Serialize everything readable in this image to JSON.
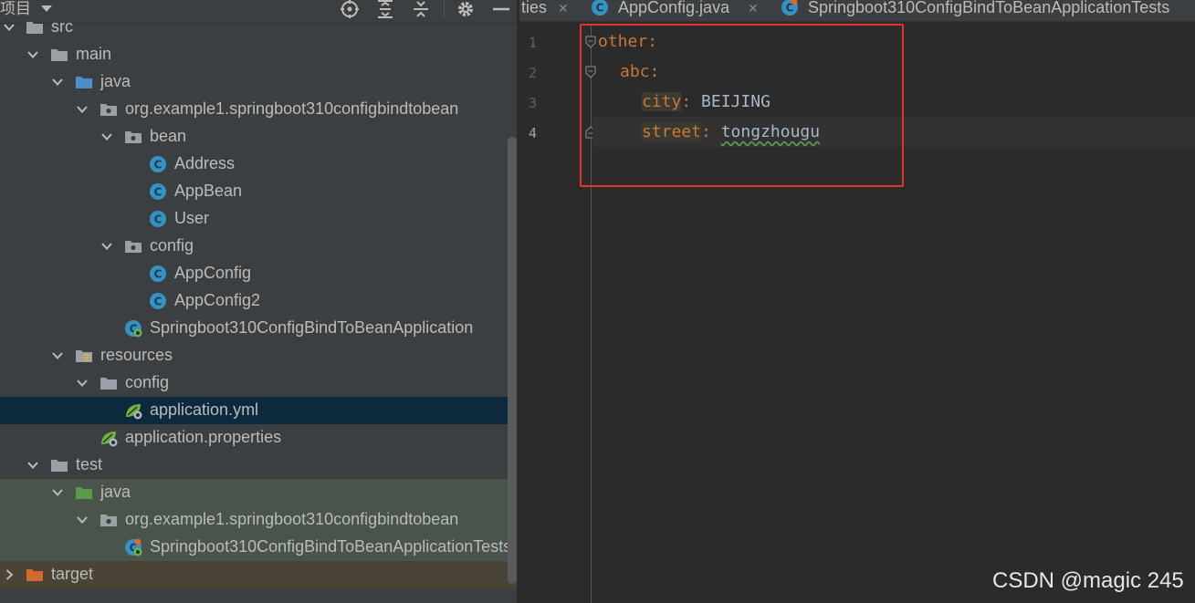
{
  "project_panel": {
    "title": "项目",
    "toolbar_icons": [
      "locate-icon",
      "expand-all-icon",
      "collapse-all-icon",
      "gear-icon",
      "minimize-icon"
    ],
    "tree": [
      {
        "label": "src",
        "icon": "folder-icon"
      },
      {
        "label": "main",
        "icon": "folder-icon"
      },
      {
        "label": "java",
        "icon": "source-folder-icon"
      },
      {
        "label": "org.example1.springboot310configbindtobean",
        "icon": "package-icon"
      },
      {
        "label": "bean",
        "icon": "package-icon"
      },
      {
        "label": "Address",
        "icon": "class-icon"
      },
      {
        "label": "AppBean",
        "icon": "class-icon"
      },
      {
        "label": "User",
        "icon": "class-icon"
      },
      {
        "label": "config",
        "icon": "package-icon"
      },
      {
        "label": "AppConfig",
        "icon": "class-icon"
      },
      {
        "label": "AppConfig2",
        "icon": "class-icon"
      },
      {
        "label": "Springboot310ConfigBindToBeanApplication",
        "icon": "spring-boot-class-icon"
      },
      {
        "label": "resources",
        "icon": "resources-folder-icon"
      },
      {
        "label": "config",
        "icon": "folder-icon"
      },
      {
        "label": "application.yml",
        "icon": "spring-config-icon"
      },
      {
        "label": "application.properties",
        "icon": "spring-config-icon"
      },
      {
        "label": "test",
        "icon": "folder-icon"
      },
      {
        "label": "java",
        "icon": "test-source-folder-icon"
      },
      {
        "label": "org.example1.springboot310configbindtobean",
        "icon": "package-icon"
      },
      {
        "label": "Springboot310ConfigBindToBeanApplicationTests",
        "icon": "spring-boot-test-icon"
      },
      {
        "label": "target",
        "icon": "excluded-folder-icon"
      }
    ],
    "selected": "application.yml"
  },
  "editor": {
    "tabs": [
      {
        "label": "ties"
      },
      {
        "label": "AppConfig.java"
      },
      {
        "label": "Springboot310ConfigBindToBeanApplicationTests"
      }
    ],
    "line_numbers": [
      "1",
      "2",
      "3",
      "4"
    ],
    "current_line": "4",
    "code": [
      {
        "key": "other",
        "sep": ":",
        "value": ""
      },
      {
        "key": "abc",
        "sep": ":",
        "value": ""
      },
      {
        "key": "city",
        "sep": ": ",
        "value": "BEIJING"
      },
      {
        "key": "street",
        "sep": ": ",
        "value": "tongzhougu"
      }
    ]
  },
  "watermark": "CSDN @magic 245",
  "colors": {
    "yaml_key": "#cc7832",
    "yaml_value": "#a9b7c6",
    "highlight_box": "#e8302c",
    "selection": "#0d293e",
    "class_icon": "#3592c4"
  }
}
